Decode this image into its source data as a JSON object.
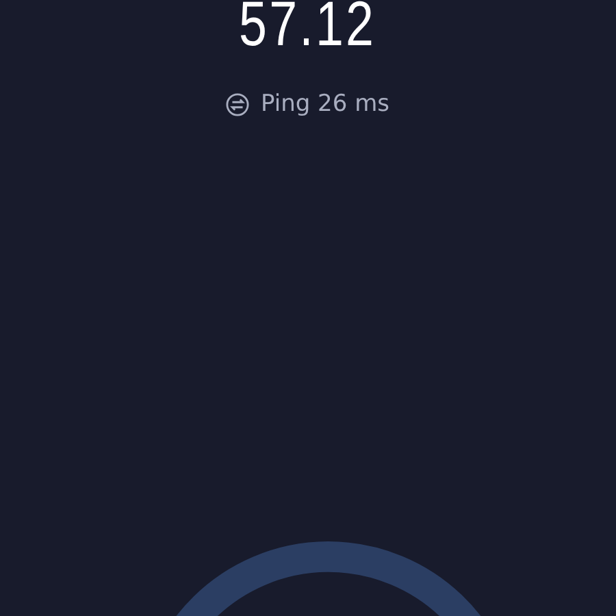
{
  "speed": {
    "value": "57.12"
  },
  "ping": {
    "label": "Ping 26 ms"
  }
}
